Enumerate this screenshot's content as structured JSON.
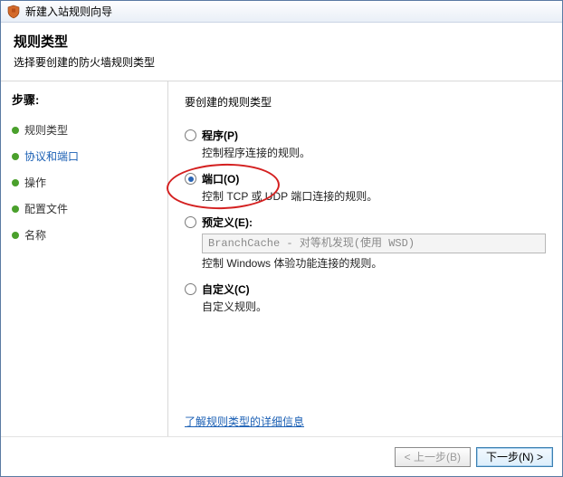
{
  "window": {
    "title": "新建入站规则向导"
  },
  "header": {
    "title": "规则类型",
    "subtitle": "选择要创建的防火墙规则类型"
  },
  "sidebar": {
    "title": "步骤:",
    "items": [
      {
        "label": "规则类型",
        "state": "done"
      },
      {
        "label": "协议和端口",
        "state": "active"
      },
      {
        "label": "操作",
        "state": "future"
      },
      {
        "label": "配置文件",
        "state": "future"
      },
      {
        "label": "名称",
        "state": "future"
      }
    ]
  },
  "content": {
    "question": "要创建的规则类型",
    "options": [
      {
        "id": "program",
        "title": "程序(P)",
        "desc": "控制程序连接的规则。",
        "checked": false
      },
      {
        "id": "port",
        "title": "端口(O)",
        "desc": "控制 TCP 或 UDP 端口连接的规则。",
        "checked": true
      },
      {
        "id": "predef",
        "title": "预定义(E):",
        "desc": "控制 Windows 体验功能连接的规则。",
        "checked": false,
        "select_value": "BranchCache - 对等机发现(使用 WSD)"
      },
      {
        "id": "custom",
        "title": "自定义(C)",
        "desc": "自定义规则。",
        "checked": false
      }
    ],
    "learn_more": "了解规则类型的详细信息"
  },
  "footer": {
    "back": "< 上一步(B)",
    "next": "下一步(N) >"
  }
}
